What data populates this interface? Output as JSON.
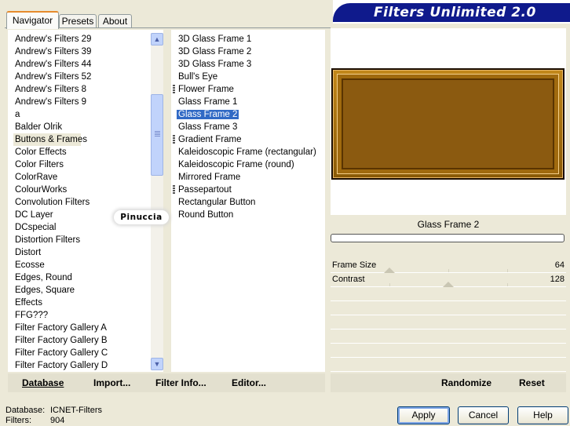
{
  "tabs": [
    {
      "label": "Navigator",
      "active": true
    },
    {
      "label": "Presets",
      "active": false
    },
    {
      "label": "About",
      "active": false
    }
  ],
  "banner": {
    "title": "Filters Unlimited 2.0"
  },
  "categories": {
    "items": [
      "Andrew's Filters 29",
      "Andrew's Filters 39",
      "Andrew's Filters 44",
      "Andrew's Filters 52",
      "Andrew's Filters 8",
      "Andrew's Filters 9",
      "a",
      "Balder Olrik",
      "Buttons & Frames",
      "Color Effects",
      "Color Filters",
      "ColorRave",
      "ColourWorks",
      "Convolution Filters",
      "DC Layer",
      "DCspecial",
      "Distortion Filters",
      "Distort",
      "Ecosse",
      "Edges, Round",
      "Edges, Square",
      "Effects",
      "FFG???",
      "Filter Factory Gallery A",
      "Filter Factory Gallery B",
      "Filter Factory Gallery C",
      "Filter Factory Gallery D"
    ],
    "selected": "Buttons & Frames"
  },
  "filters": {
    "items": [
      {
        "label": "3D Glass Frame 1",
        "grip": false
      },
      {
        "label": "3D Glass Frame 2",
        "grip": false
      },
      {
        "label": "3D Glass Frame 3",
        "grip": false
      },
      {
        "label": "Bull's Eye",
        "grip": false
      },
      {
        "label": "Flower Frame",
        "grip": true
      },
      {
        "label": "Glass Frame 1",
        "grip": false
      },
      {
        "label": "Glass Frame 2",
        "grip": false
      },
      {
        "label": "Glass Frame 3",
        "grip": false
      },
      {
        "label": "Gradient Frame",
        "grip": true
      },
      {
        "label": "Kaleidoscopic Frame (rectangular)",
        "grip": false
      },
      {
        "label": "Kaleidoscopic Frame (round)",
        "grip": false
      },
      {
        "label": "Mirrored Frame",
        "grip": false
      },
      {
        "label": "Passepartout",
        "grip": true
      },
      {
        "label": "Rectangular Button",
        "grip": false
      },
      {
        "label": "Round Button",
        "grip": false
      }
    ],
    "selected": "Glass Frame 2"
  },
  "watermark": {
    "text": "Pinuccia"
  },
  "preview": {
    "filter_name": "Glass Frame 2",
    "progress": 0
  },
  "params": [
    {
      "label": "Frame Size",
      "value": "64",
      "max": 255
    },
    {
      "label": "Contrast",
      "value": "128",
      "max": 255
    }
  ],
  "toolbar": {
    "database_label": "Database",
    "import_label": "Import...",
    "filter_info_label": "Filter Info...",
    "editor_label": "Editor...",
    "randomize_label": "Randomize",
    "reset_label": "Reset"
  },
  "status": {
    "database_label": "Database:",
    "database_value": "ICNET-Filters",
    "filters_label": "Filters:",
    "filters_value": "904"
  },
  "dialog": {
    "apply_label": "Apply",
    "cancel_label": "Cancel",
    "help_label": "Help"
  },
  "colors": {
    "accent": "#0f1a8c",
    "selection": "#316ac5",
    "tab_highlight": "#e68b2c"
  }
}
